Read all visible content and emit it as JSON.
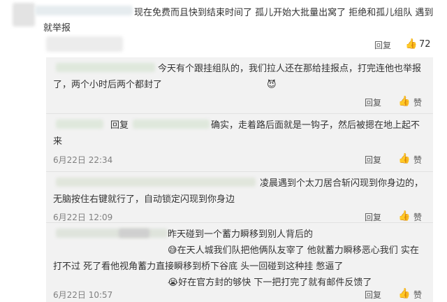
{
  "main_comment": {
    "text": "现在免费而且快到结束时间了 孤儿开始大批量出窝了 拒绝和孤儿组队 遇到就举报",
    "reply_label": "回复",
    "like_count": "72",
    "icons": [
      "reply-icon",
      "thumb-up-icon"
    ]
  },
  "replies": [
    {
      "text": "今天有个跟挂组队的，我们拉人还在那给挂报点，打完连他也举报了，两个小时后两个都封了",
      "emoji": "😈",
      "time": "",
      "reply_label": "回复",
      "like_label": "赞"
    },
    {
      "prefix": "回复",
      "text": "确实，走着路后面就是一钩子，然后被摁在地上起不来",
      "time": "6月22日 22:34",
      "reply_label": "回复",
      "like_label": "赞"
    },
    {
      "text": "凌晨遇到个太刀居合斩闪现到你身边的，无脑按住右键就行了，自动锁定闪现到你身边",
      "time": "6月22日 12:09",
      "reply_label": "回复",
      "like_label": "赞"
    },
    {
      "text_a": "昨天碰到一个蓄力瞬移到别人背后的",
      "emoji_a": "😅",
      "text_b": "在天人城我们队把他俩队友宰了 他就蓄力瞬移恶心我们 实在打不过 死了看他视角蓄力直接瞬移到桥下谷底 头一回碰到这种挂 憋逼了",
      "emoji_b": "😭",
      "text_c": "好在官方封的够快 下一把打完了就有邮件反馈了",
      "time": "6月22日 10:57",
      "reply_label": "回复",
      "like_label": "赞"
    }
  ]
}
